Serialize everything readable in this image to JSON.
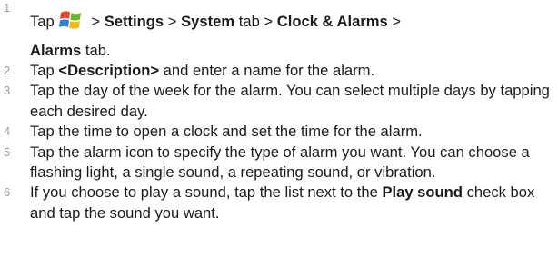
{
  "steps": [
    {
      "number": "1",
      "parts": {
        "tap": "Tap",
        "sep1": "> ",
        "settings": "Settings",
        "sep2": " > ",
        "system_tab": "System",
        "tab_word": " tab > ",
        "clock_alarms": "Clock & Alarms",
        "sep3": " >",
        "alarms": "Alarms",
        "tab_end": " tab."
      }
    },
    {
      "number": "2",
      "parts": {
        "tap": "Tap ",
        "desc": "<Description>",
        "rest": " and enter a name for the alarm."
      }
    },
    {
      "number": "3",
      "text": "Tap the day of the week for the alarm. You can select multiple days by tapping each desired day."
    },
    {
      "number": "4",
      "text": "Tap the time to open a clock and set the time for the alarm."
    },
    {
      "number": "5",
      "text": "Tap the alarm icon to specify the type of alarm you want. You can choose a flashing light, a single sound, a repeating sound, or vibration."
    },
    {
      "number": "6",
      "parts": {
        "pre": "If you choose to play a sound, tap the list next to the ",
        "play_sound": "Play sound",
        "post": " check box and tap the sound you want."
      }
    }
  ],
  "icons": {
    "start": "windows-start-logo-icon"
  },
  "colors": {
    "text": "#1a1a1a",
    "step_number": "#9a9a9a",
    "logo_red": "#e8442b",
    "logo_green": "#6cb82d",
    "logo_blue": "#2f7fd6",
    "logo_yellow": "#f5b90e"
  }
}
